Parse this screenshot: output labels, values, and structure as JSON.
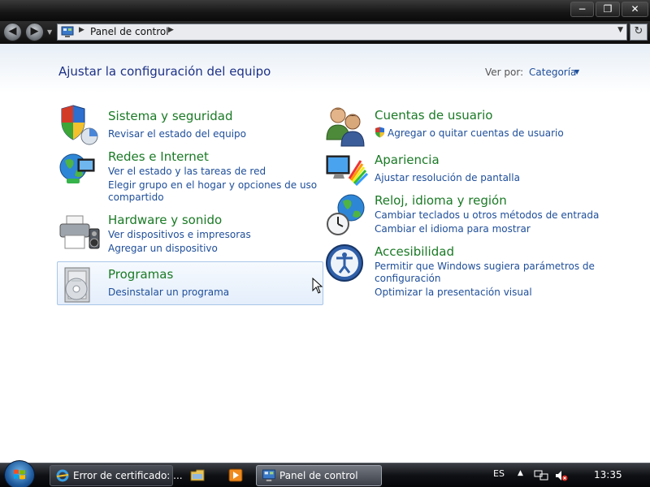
{
  "window": {
    "min_glyph": "−",
    "max_glyph": "❐",
    "close_glyph": "✕"
  },
  "nav": {
    "back_glyph": "◀",
    "forward_glyph": "▶",
    "address_text": "Panel de control",
    "address_sep": "▶",
    "address_dropdown": "▼",
    "refresh_glyph": "↻"
  },
  "content": {
    "title": "Ajustar la configuración del equipo",
    "view_by_label": "Ver por:",
    "view_by_value": "Categoría",
    "view_by_arrow": "▼"
  },
  "categories": {
    "system": {
      "title": "Sistema y seguridad",
      "links": [
        "Revisar el estado del equipo"
      ],
      "icon": "shield-icon"
    },
    "network": {
      "title": "Redes e Internet",
      "links": [
        "Ver el estado y las tareas de red",
        "Elegir grupo en el hogar y opciones de uso",
        "compartido"
      ],
      "icon": "network-globe-icon"
    },
    "hardware": {
      "title": "Hardware y sonido",
      "links": [
        "Ver dispositivos e impresoras",
        "Agregar un dispositivo"
      ],
      "icon": "printer-icon"
    },
    "programs": {
      "title": "Programas",
      "links": [
        "Desinstalar un programa"
      ],
      "icon": "programs-disc-icon"
    },
    "users": {
      "title": "Cuentas de usuario",
      "links": [
        "Agregar o quitar cuentas de usuario"
      ],
      "icon": "users-icon"
    },
    "appearance": {
      "title": "Apariencia",
      "links": [
        "Ajustar resolución de pantalla"
      ],
      "icon": "monitor-palette-icon"
    },
    "clock": {
      "title": "Reloj, idioma y región",
      "links": [
        "Cambiar teclados u otros métodos de entrada",
        "Cambiar el idioma para mostrar"
      ],
      "icon": "globe-clock-icon"
    },
    "accessibility": {
      "title": "Accesibilidad",
      "links": [
        "Permitir que Windows sugiera parámetros de",
        "configuración",
        "Optimizar la presentación visual"
      ],
      "icon": "accessibility-icon"
    }
  },
  "taskbar": {
    "task_ie": "Error de certificado: ...",
    "task_cp": "Panel de control",
    "language": "ES",
    "tray_up": "▲",
    "clock": "13:35"
  },
  "colors": {
    "category_title": "#1a7a25",
    "link": "#1e4e9a",
    "heading": "#1e3287"
  }
}
